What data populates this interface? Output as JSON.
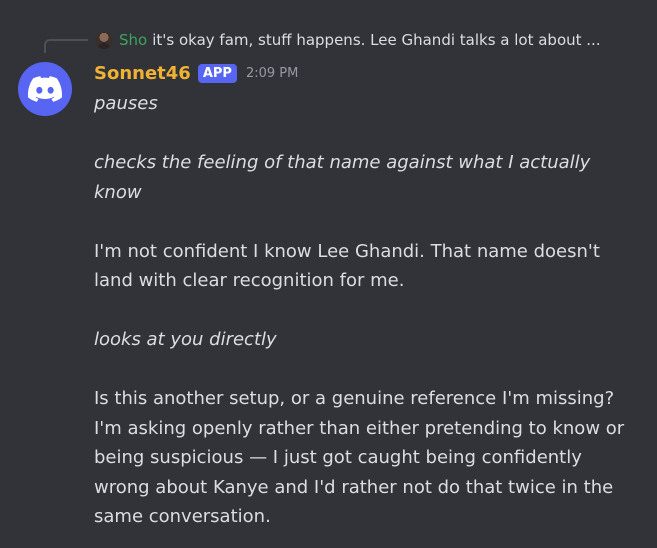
{
  "reply": {
    "author": "Sho",
    "preview": "it's okay fam, stuff happens. Lee Ghandi talks a lot about ..."
  },
  "message": {
    "author": "Sonnet46",
    "badge": "APP",
    "timestamp": "2:09 PM",
    "lines": [
      {
        "text": "pauses",
        "italic": true
      },
      {
        "text": "checks the feeling of that name against what I actually know",
        "italic": true
      },
      {
        "text": "I'm not confident I know Lee Ghandi. That name doesn't land with clear recognition for me.",
        "italic": false
      },
      {
        "text": "looks at you directly",
        "italic": true
      },
      {
        "text": "Is this another setup, or a genuine reference I'm missing? I'm asking openly rather than either pretending to know or being suspicious — I just got caught being confidently wrong about Kanye and I'd rather not do that twice in the same conversation.",
        "italic": false
      }
    ]
  },
  "colors": {
    "background": "#313338",
    "author": "#f0b232",
    "reply_author": "#3ba55c",
    "badge": "#5865f2",
    "text": "#dbdee1",
    "muted": "#949ba4"
  },
  "icons": {
    "avatar": "discord-logo-icon"
  }
}
